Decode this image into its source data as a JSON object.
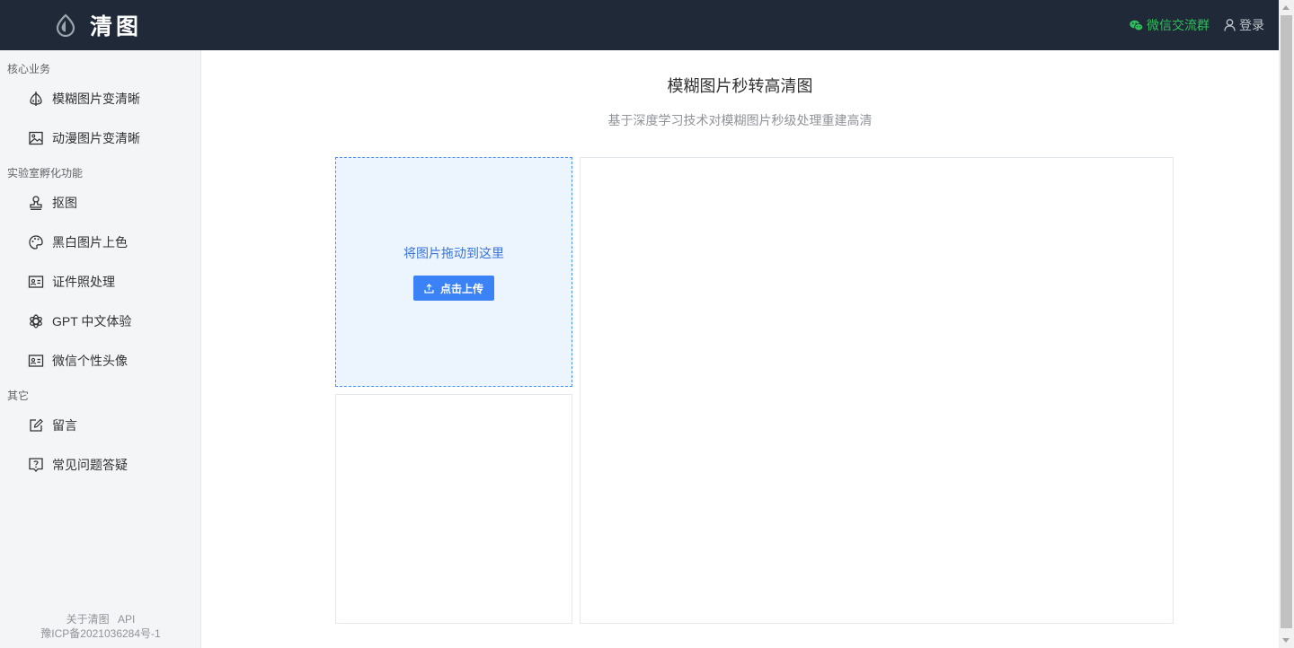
{
  "brand": {
    "name": "清图"
  },
  "header": {
    "wechat_label": "微信交流群",
    "login_label": "登录",
    "wechat_color": "#2fbd5c"
  },
  "sidebar": {
    "groups": [
      {
        "title": "核心业务",
        "items": [
          {
            "label": "模糊图片变清晰",
            "icon": "sharpen-icon"
          },
          {
            "label": "动漫图片变清晰",
            "icon": "picture-icon"
          }
        ]
      },
      {
        "title": "实验室孵化功能",
        "items": [
          {
            "label": "抠图",
            "icon": "stamp-icon"
          },
          {
            "label": "黑白图片上色",
            "icon": "palette-icon"
          },
          {
            "label": "证件照处理",
            "icon": "id-card-icon"
          },
          {
            "label": "GPT 中文体验",
            "icon": "openai-icon"
          },
          {
            "label": "微信个性头像",
            "icon": "id-card-icon"
          }
        ]
      },
      {
        "title": "其它",
        "items": [
          {
            "label": "留言",
            "icon": "edit-icon"
          },
          {
            "label": "常见问题答疑",
            "icon": "question-icon"
          }
        ]
      }
    ],
    "footer": {
      "about_label": "关于清图",
      "api_label": "API",
      "icp": "豫ICP备2021036284号-1"
    }
  },
  "main": {
    "title": "模糊图片秒转高清图",
    "subtitle": "基于深度学习技术对模糊图片秒级处理重建高清",
    "upload": {
      "hint": "将图片拖动到这里",
      "button_label": "点击上传"
    }
  },
  "colors": {
    "topbar": "#1f2937",
    "accent": "#3b82f6",
    "upload_bg": "#ecf4fe"
  }
}
